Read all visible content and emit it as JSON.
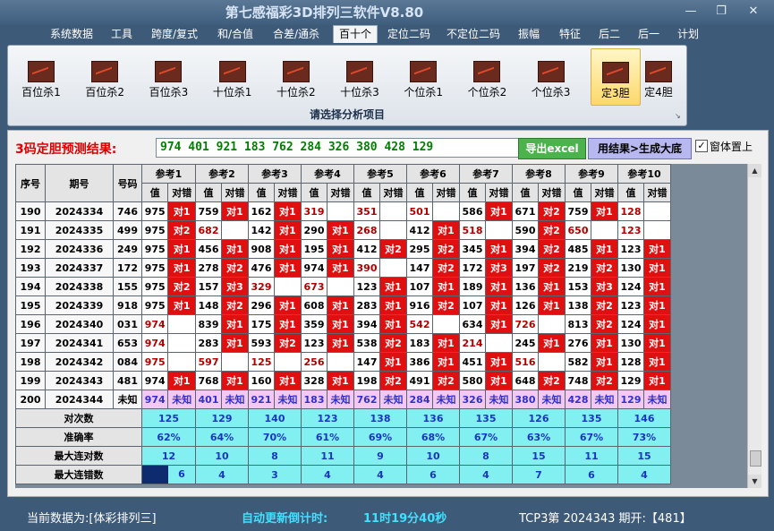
{
  "window": {
    "title": "第七感福彩3D排列三软件V8.80",
    "min_icon": "minimize-icon",
    "max_icon": "restore-icon",
    "close_icon": "close-icon"
  },
  "menu": [
    "系统数据",
    "工具",
    "跨度/复式",
    "和/合值",
    "合差/通杀",
    "百十个",
    "定位二码",
    "不定位二码",
    "振幅",
    "特征",
    "后二",
    "后一",
    "计划"
  ],
  "active_menu_index": 5,
  "toolbar": {
    "items": [
      "百位杀1",
      "百位杀2",
      "百位杀3",
      "十位杀1",
      "十位杀2",
      "十位杀3",
      "个位杀1",
      "个位杀2",
      "个位杀3",
      "定3胆",
      "定4胆"
    ],
    "selected_index": 9,
    "group_caption": "请选择分析项目"
  },
  "prediction": {
    "label": "3码定胆预测结果:",
    "value": "974 401 921 183 762 284 326 380 428 129",
    "export_button": "导出excel",
    "generate_button": "用结果>生成大底",
    "pin_checked": true,
    "pin_label": "窗体置上"
  },
  "table": {
    "headers": {
      "seq": "序号",
      "period": "期号",
      "number": "号码",
      "value": "值",
      "result": "对错"
    },
    "refs": [
      "参考1",
      "参考2",
      "参考3",
      "参考4",
      "参考5",
      "参考6",
      "参考7",
      "参考8",
      "参考9",
      "参考10"
    ],
    "rows": [
      {
        "seq": "190",
        "period": "2024334",
        "number": "746",
        "cells": [
          [
            "975",
            "对1"
          ],
          [
            "759",
            "对1"
          ],
          [
            "162",
            "对1"
          ],
          [
            "319",
            ""
          ],
          [
            "351",
            ""
          ],
          [
            "501",
            ""
          ],
          [
            "586",
            "对1"
          ],
          [
            "671",
            "对2"
          ],
          [
            "759",
            "对1"
          ],
          [
            "128",
            ""
          ]
        ]
      },
      {
        "seq": "191",
        "period": "2024335",
        "number": "499",
        "cells": [
          [
            "975",
            "对2"
          ],
          [
            "682",
            ""
          ],
          [
            "142",
            "对1"
          ],
          [
            "290",
            "对1"
          ],
          [
            "268",
            ""
          ],
          [
            "412",
            "对1"
          ],
          [
            "518",
            ""
          ],
          [
            "590",
            "对2"
          ],
          [
            "650",
            ""
          ],
          [
            "123",
            ""
          ]
        ]
      },
      {
        "seq": "192",
        "period": "2024336",
        "number": "249",
        "cells": [
          [
            "975",
            "对1"
          ],
          [
            "456",
            "对1"
          ],
          [
            "908",
            "对1"
          ],
          [
            "195",
            "对1"
          ],
          [
            "412",
            "对2"
          ],
          [
            "295",
            "对2"
          ],
          [
            "345",
            "对1"
          ],
          [
            "394",
            "对2"
          ],
          [
            "485",
            "对1"
          ],
          [
            "123",
            "对1"
          ]
        ]
      },
      {
        "seq": "193",
        "period": "2024337",
        "number": "172",
        "cells": [
          [
            "975",
            "对1"
          ],
          [
            "278",
            "对2"
          ],
          [
            "476",
            "对1"
          ],
          [
            "974",
            "对1"
          ],
          [
            "390",
            ""
          ],
          [
            "147",
            "对2"
          ],
          [
            "172",
            "对3"
          ],
          [
            "197",
            "对2"
          ],
          [
            "219",
            "对2"
          ],
          [
            "130",
            "对1"
          ]
        ]
      },
      {
        "seq": "194",
        "period": "2024338",
        "number": "155",
        "cells": [
          [
            "975",
            "对2"
          ],
          [
            "157",
            "对3"
          ],
          [
            "329",
            ""
          ],
          [
            "673",
            ""
          ],
          [
            "123",
            "对1"
          ],
          [
            "107",
            "对1"
          ],
          [
            "189",
            "对1"
          ],
          [
            "136",
            "对1"
          ],
          [
            "153",
            "对3"
          ],
          [
            "124",
            "对1"
          ]
        ]
      },
      {
        "seq": "195",
        "period": "2024339",
        "number": "918",
        "cells": [
          [
            "975",
            "对1"
          ],
          [
            "148",
            "对2"
          ],
          [
            "296",
            "对1"
          ],
          [
            "608",
            "对1"
          ],
          [
            "283",
            "对1"
          ],
          [
            "916",
            "对2"
          ],
          [
            "107",
            "对1"
          ],
          [
            "126",
            "对1"
          ],
          [
            "138",
            "对2"
          ],
          [
            "123",
            "对1"
          ]
        ]
      },
      {
        "seq": "196",
        "period": "2024340",
        "number": "031",
        "cells": [
          [
            "974",
            ""
          ],
          [
            "839",
            "对1"
          ],
          [
            "175",
            "对1"
          ],
          [
            "359",
            "对1"
          ],
          [
            "394",
            "对1"
          ],
          [
            "542",
            ""
          ],
          [
            "634",
            "对1"
          ],
          [
            "726",
            ""
          ],
          [
            "813",
            "对2"
          ],
          [
            "124",
            "对1"
          ]
        ]
      },
      {
        "seq": "197",
        "period": "2024341",
        "number": "653",
        "cells": [
          [
            "974",
            ""
          ],
          [
            "283",
            "对1"
          ],
          [
            "593",
            "对2"
          ],
          [
            "123",
            "对1"
          ],
          [
            "538",
            "对2"
          ],
          [
            "183",
            "对1"
          ],
          [
            "214",
            ""
          ],
          [
            "245",
            "对1"
          ],
          [
            "276",
            "对1"
          ],
          [
            "130",
            "对1"
          ]
        ]
      },
      {
        "seq": "198",
        "period": "2024342",
        "number": "084",
        "cells": [
          [
            "975",
            ""
          ],
          [
            "597",
            ""
          ],
          [
            "125",
            ""
          ],
          [
            "256",
            ""
          ],
          [
            "147",
            "对1"
          ],
          [
            "386",
            "对1"
          ],
          [
            "451",
            "对1"
          ],
          [
            "516",
            ""
          ],
          [
            "582",
            "对1"
          ],
          [
            "128",
            "对1"
          ]
        ]
      },
      {
        "seq": "199",
        "period": "2024343",
        "number": "481",
        "cells": [
          [
            "974",
            "对1"
          ],
          [
            "768",
            "对1"
          ],
          [
            "160",
            "对1"
          ],
          [
            "328",
            "对1"
          ],
          [
            "198",
            "对2"
          ],
          [
            "491",
            "对2"
          ],
          [
            "580",
            "对1"
          ],
          [
            "648",
            "对2"
          ],
          [
            "748",
            "对2"
          ],
          [
            "129",
            "对1"
          ]
        ]
      }
    ],
    "pred_row": {
      "seq": "200",
      "period": "2024344",
      "number": "未知",
      "values": [
        "974",
        "401",
        "921",
        "183",
        "762",
        "284",
        "326",
        "380",
        "428",
        "129"
      ],
      "result": "未知"
    },
    "stats": [
      {
        "label": "对次数",
        "values": [
          "125",
          "129",
          "140",
          "123",
          "138",
          "136",
          "135",
          "126",
          "135",
          "146"
        ]
      },
      {
        "label": "准确率",
        "values": [
          "62%",
          "64%",
          "70%",
          "61%",
          "69%",
          "68%",
          "67%",
          "63%",
          "67%",
          "73%"
        ]
      },
      {
        "label": "最大连对数",
        "values": [
          "12",
          "10",
          "8",
          "11",
          "9",
          "10",
          "8",
          "15",
          "11",
          "15"
        ]
      },
      {
        "label": "最大连错数",
        "values": [
          "6",
          "4",
          "3",
          "4",
          "4",
          "6",
          "4",
          "7",
          "6",
          "4"
        ]
      }
    ]
  },
  "status": {
    "current_data": "当前数据为:[体彩排列三]",
    "countdown_label": "自动更新倒计时:",
    "countdown_value": "11时19分40秒",
    "issue_info": "TCP3第  2024343  期开:【481】"
  },
  "colors": {
    "hit": "#e01010",
    "pred": "#f3c8f3",
    "stat": "#82f0f0",
    "title": "#d6e4f4"
  }
}
